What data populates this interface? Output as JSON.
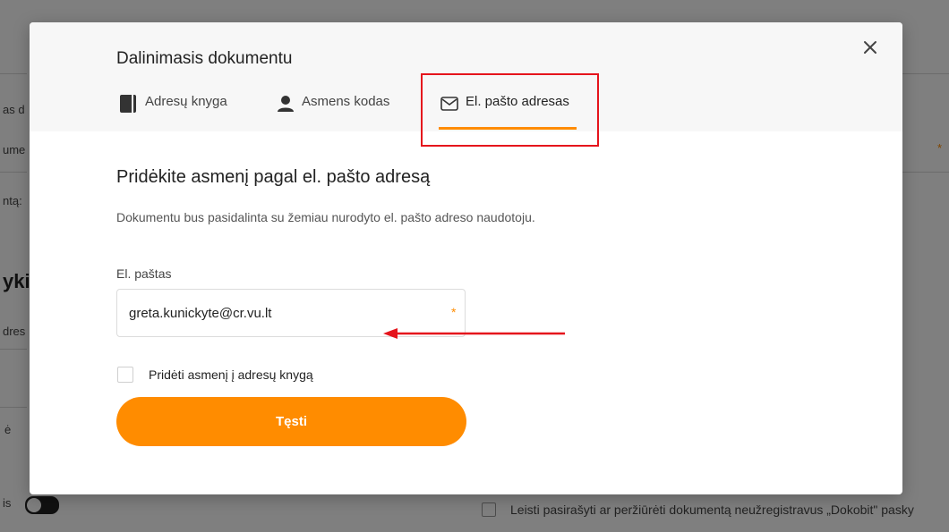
{
  "background": {
    "fragments": [
      "as d",
      "ume",
      "ntą:",
      "ykit",
      "dres",
      "ė",
      "is"
    ],
    "required_mark": "*",
    "checkbox_label": "Leisti pasirašyti ar peržiūrėti dokumentą neužregistravus „Dokobit\" pasky"
  },
  "modal": {
    "title": "Dalinimasis dokumentu",
    "tabs": [
      {
        "label": "Adresų knyga",
        "icon": "book-icon"
      },
      {
        "label": "Asmens kodas",
        "icon": "person-icon"
      },
      {
        "label": "El. pašto adresas",
        "icon": "envelope-icon",
        "active": true
      }
    ],
    "section_title": "Pridėkite asmenį pagal el. pašto adresą",
    "description": "Dokumentu bus pasidalinta su žemiau nurodyto el. pašto adreso naudotoju.",
    "email_label": "El. paštas",
    "email_value": "greta.kunickyte@cr.vu.lt",
    "required_mark": "*",
    "add_to_book_label": "Pridėti asmenį į adresų knygą",
    "continue_label": "Tęsti"
  },
  "colors": {
    "accent": "#ff8c00",
    "annotation": "#e5141c"
  }
}
